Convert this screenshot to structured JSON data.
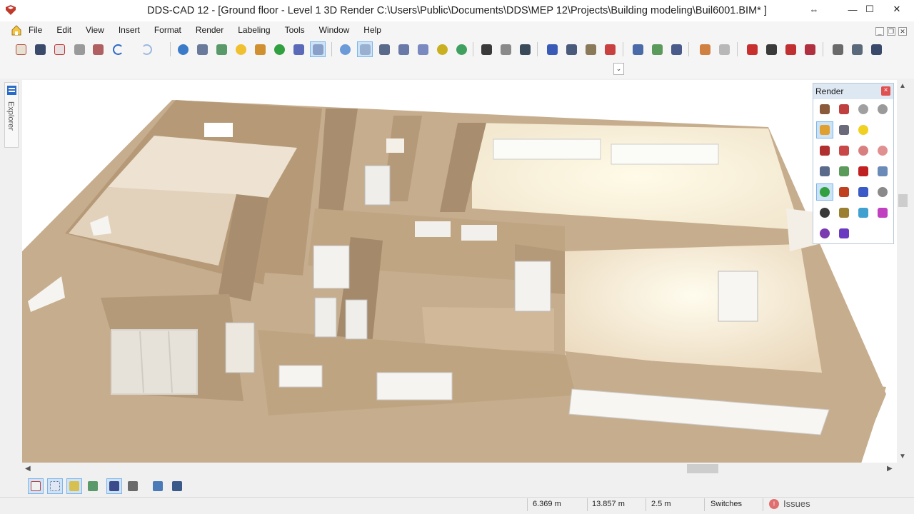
{
  "window": {
    "title": "DDS-CAD 12 - [Ground floor - Level 1  3D  Render  C:\\Users\\Public\\Documents\\DDS\\MEP 12\\Projects\\Building modeling\\Buil6001.BIM* ]",
    "move_glyph": "⇔",
    "minimize_glyph": "—",
    "maximize_glyph": "☐",
    "close_glyph": "✕"
  },
  "menu": {
    "items": [
      "File",
      "Edit",
      "View",
      "Insert",
      "Format",
      "Render",
      "Labeling",
      "Tools",
      "Window",
      "Help"
    ]
  },
  "mdi": {
    "minimize": "_",
    "restore": "❐",
    "close": "✕"
  },
  "command": {
    "value": "",
    "dropdown_glyph": "⌄"
  },
  "explorer": {
    "label": "Explorer"
  },
  "render_panel": {
    "title": "Render",
    "close_glyph": "×"
  },
  "scroll": {
    "up": "▲",
    "down": "▼",
    "left": "◀",
    "right": "▶"
  },
  "status": {
    "x": "6.369 m",
    "y": "13.857 m",
    "grid": "2.5 m",
    "mode": "Switches",
    "issues_label": "Issues",
    "issues_glyph": "!"
  },
  "colors": {
    "wall": "#c6ad8d",
    "wall_dark": "#a88e6e",
    "wall_light": "#d8c4a8",
    "floor": "#fbf4ea",
    "glow": "#fff6dc",
    "accent_blue": "#7eb4ea"
  }
}
